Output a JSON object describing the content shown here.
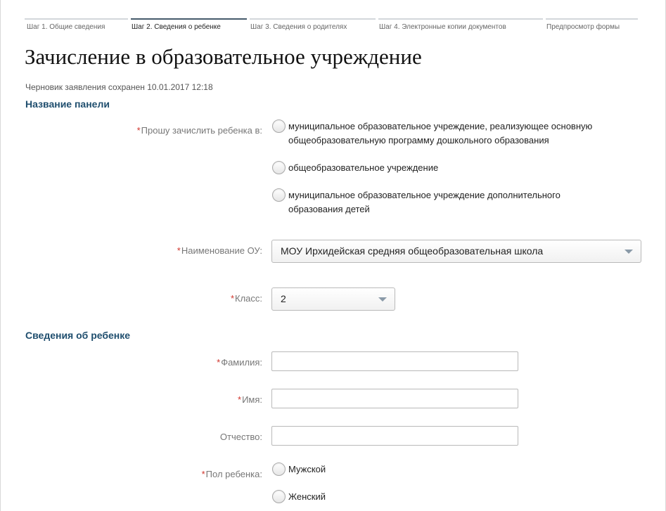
{
  "steps": [
    {
      "label": "Шаг 1. Общие сведения",
      "active": false
    },
    {
      "label": "Шаг 2. Сведения о ребенке",
      "active": true
    },
    {
      "label": "Шаг 3. Сведения о родителях",
      "active": false
    },
    {
      "label": "Шаг 4. Электронные копии документов",
      "active": false
    },
    {
      "label": "Предпросмотр формы",
      "active": false
    }
  ],
  "page": {
    "title": "Зачисление в образовательное учреждение",
    "draft_status": "Черновик заявления сохранен 10.01.2017 12:18"
  },
  "panel": {
    "heading": "Название панели",
    "enroll_label": "Прошу зачислить ребенка в:",
    "enroll_options": [
      "муниципальное образовательное учреждение, реализующее основную общеобразовательную программу дошкольного образования",
      "общеобразовательное учреждение",
      "муниципальное образовательное учреждение дополнительного образования детей"
    ],
    "school_label": "Наименование ОУ:",
    "school_value": "МОУ Ирхидейская средняя общеобразовательная школа",
    "class_label": "Класс:",
    "class_value": "2"
  },
  "child": {
    "heading": "Сведения об ребенке",
    "surname_label": "Фамилия:",
    "surname_value": "",
    "name_label": "Имя:",
    "name_value": "",
    "patronymic_label": "Отчество:",
    "patronymic_value": "",
    "gender_label": "Пол ребенка:",
    "gender_options": [
      "Мужской",
      "Женский"
    ]
  },
  "required_mark": "*"
}
